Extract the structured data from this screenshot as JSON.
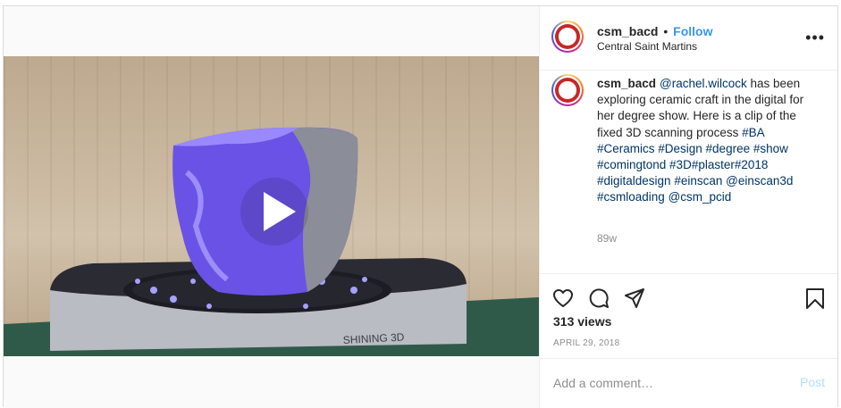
{
  "post": {
    "username": "csm_bacd",
    "separator": "•",
    "follow_label": "Follow",
    "location": "Central Saint Martins",
    "more_icon": "•••",
    "caption": {
      "mention_1": "@rachel.wilcock",
      "text_1": " has been exploring ceramic craft in the digital for her degree show. Here is a clip of the fixed 3D scanning process ",
      "hashtags_1": "#BA #Ceramics #Design #degree #show #comingtond #3D#plaster#2018 #digitaldesign #einscan",
      "mention_2": "@einscan3d",
      "hashtag_2": "#csmloading",
      "mention_3": "@csm_pcid"
    },
    "age": "89w",
    "views": "313 views",
    "date": "APRIL 29, 2018",
    "comment_placeholder": "Add a comment…",
    "post_label": "Post"
  },
  "colors": {
    "link": "#003569",
    "follow": "#3897f0",
    "post_disabled": "#b2dffc",
    "muted": "#8e8e8e"
  },
  "icons": {
    "play": "play-icon",
    "like": "heart-icon",
    "comment": "comment-icon",
    "share": "share-icon",
    "save": "bookmark-icon"
  }
}
